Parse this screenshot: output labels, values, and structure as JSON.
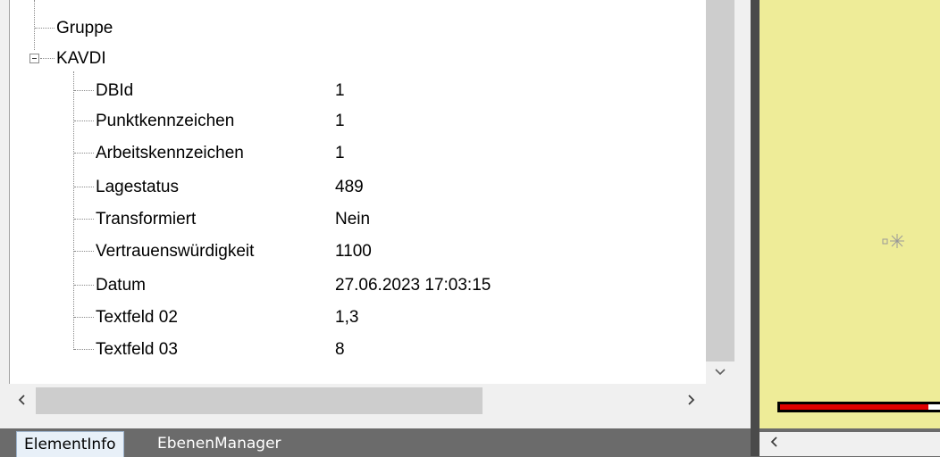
{
  "tree": {
    "group_node": "Gruppe",
    "kavdi_node": "KAVDI",
    "properties": [
      {
        "name": "DBId",
        "value": "1"
      },
      {
        "name": "Punktkennzeichen",
        "value": "1"
      },
      {
        "name": "Arbeitskennzeichen",
        "value": "1"
      },
      {
        "name": "Lagestatus",
        "value": "489"
      },
      {
        "name": "Transformiert",
        "value": "Nein"
      },
      {
        "name": "Vertrauenswürdigkeit",
        "value": "1100"
      },
      {
        "name": "Datum",
        "value": "27.06.2023 17:03:15"
      },
      {
        "name": "Textfeld 02",
        "value": "1,3"
      },
      {
        "name": "Textfeld 03",
        "value": "8"
      }
    ]
  },
  "tabs": {
    "element_info": "ElementInfo",
    "ebenen_manager": "EbenenManager"
  },
  "icons": {
    "vscroll_down": "chevron-down-icon",
    "hscroll_left": "chevron-left-icon",
    "hscroll_right": "chevron-right-icon",
    "point_symbol": "point-marker-icon"
  },
  "colors": {
    "canvas_background": "#eeec98",
    "measure_bar": "#e00000"
  }
}
